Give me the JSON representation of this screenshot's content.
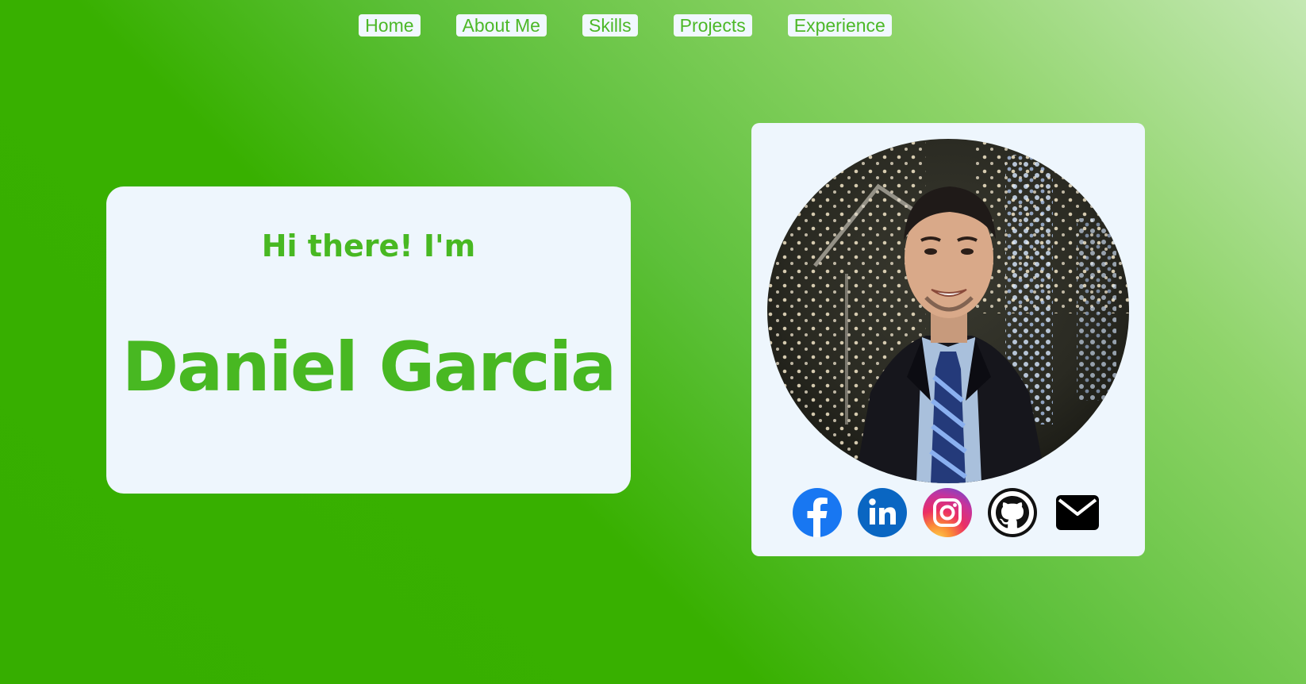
{
  "nav": {
    "items": [
      {
        "label": "Home"
      },
      {
        "label": "About Me"
      },
      {
        "label": "Skills"
      },
      {
        "label": "Projects"
      },
      {
        "label": "Experience"
      }
    ]
  },
  "hero": {
    "greeting": "Hi there! I'm",
    "name": "Daniel Garcia"
  },
  "profile": {
    "photo_alt": "profile photo",
    "socials": [
      {
        "icon": "facebook-icon",
        "color": "#1877f2"
      },
      {
        "icon": "linkedin-icon",
        "color": "#0a66c2"
      },
      {
        "icon": "instagram-icon",
        "color": "#e1306c"
      },
      {
        "icon": "github-icon",
        "color": "#111111"
      },
      {
        "icon": "email-icon",
        "color": "#000000"
      }
    ]
  },
  "colors": {
    "accent": "#4cb828",
    "card_background": "#eef6fd",
    "gradient_dark": "#36ae00",
    "gradient_light": "#c4e8b3"
  }
}
